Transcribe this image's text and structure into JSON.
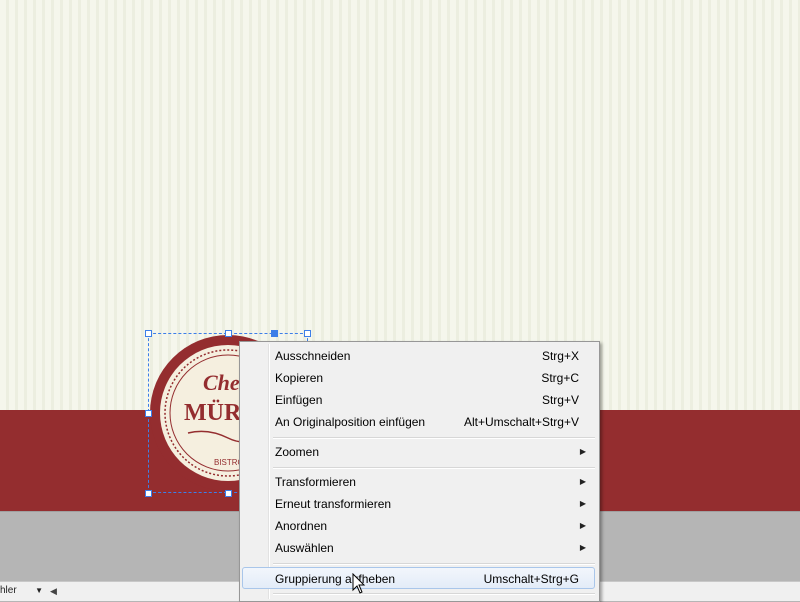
{
  "canvas": {
    "background_color": "#f3f4e8",
    "band_color": "#942d2f",
    "pasteboard_color": "#b5b5b5"
  },
  "logo": {
    "line1": "Che",
    "line2": "MÜRI",
    "line3": "BISTRO",
    "color": "#942d2f"
  },
  "status_bar": {
    "zoom_text": "hler"
  },
  "context_menu": {
    "items": [
      {
        "label": "Ausschneiden",
        "shortcut": "Strg+X"
      },
      {
        "label": "Kopieren",
        "shortcut": "Strg+C"
      },
      {
        "label": "Einfügen",
        "shortcut": "Strg+V"
      },
      {
        "label": "An Originalposition einfügen",
        "shortcut": "Alt+Umschalt+Strg+V"
      },
      {
        "label": "Zoomen",
        "shortcut": ""
      },
      {
        "label": "Transformieren",
        "shortcut": ""
      },
      {
        "label": "Erneut transformieren",
        "shortcut": ""
      },
      {
        "label": "Anordnen",
        "shortcut": ""
      },
      {
        "label": "Auswählen",
        "shortcut": ""
      },
      {
        "label": "Gruppierung aufheben",
        "shortcut": "Umschalt+Strg+G"
      }
    ],
    "hovered_item": "Gruppierung aufheben"
  }
}
